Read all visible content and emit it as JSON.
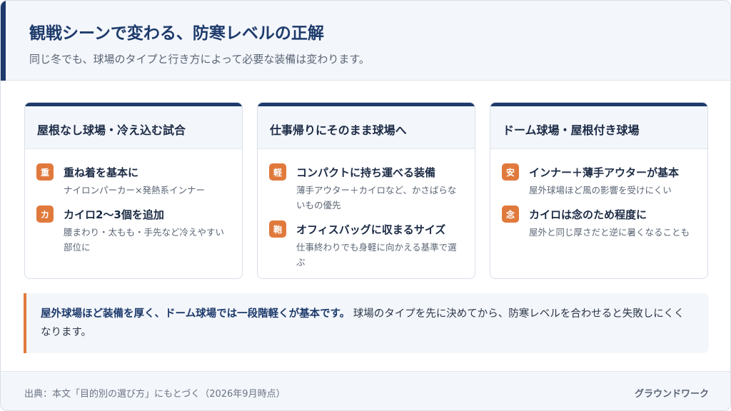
{
  "header": {
    "title": "観戦シーンで変わる、防寒レベルの正解",
    "subtitle": "同じ冬でも、球場のタイプと行き方によって必要な装備は変わります。"
  },
  "cards": [
    {
      "title": "屋根なし球場・冷え込む試合",
      "items": [
        {
          "badge": "重",
          "title": "重ね着を基本に",
          "desc": "ナイロンパーカー×発熱系インナー"
        },
        {
          "badge": "カ",
          "title": "カイロ2〜3個を追加",
          "desc": "腰まわり・太もも・手先など冷えやすい部位に"
        }
      ]
    },
    {
      "title": "仕事帰りにそのまま球場へ",
      "items": [
        {
          "badge": "軽",
          "title": "コンパクトに持ち運べる装備",
          "desc": "薄手アウター＋カイロなど、かさばらないもの優先"
        },
        {
          "badge": "鞄",
          "title": "オフィスバッグに収まるサイズ",
          "desc": "仕事終わりでも身軽に向かえる基準で選ぶ"
        }
      ]
    },
    {
      "title": "ドーム球場・屋根付き球場",
      "items": [
        {
          "badge": "安",
          "title": "インナー＋薄手アウターが基本",
          "desc": "屋外球場ほど風の影響を受けにくい"
        },
        {
          "badge": "念",
          "title": "カイロは念のため程度に",
          "desc": "屋外と同じ厚さだと逆に暑くなることも"
        }
      ]
    }
  ],
  "callout": {
    "strong": "屋外球場ほど装備を厚く、ドーム球場では一段階軽くが基本です。",
    "text": " 球場のタイプを先に決めてから、防寒レベルを合わせると失敗しにくくなります。"
  },
  "footer": {
    "source": "出典：本文「目的別の選び方」にもとづく（2026年9月時点）",
    "brand": "グラウンドワーク"
  },
  "colors": {
    "navy": "#1d3a6b",
    "orange": "#e07a3c",
    "panel": "#f3f6fb"
  }
}
